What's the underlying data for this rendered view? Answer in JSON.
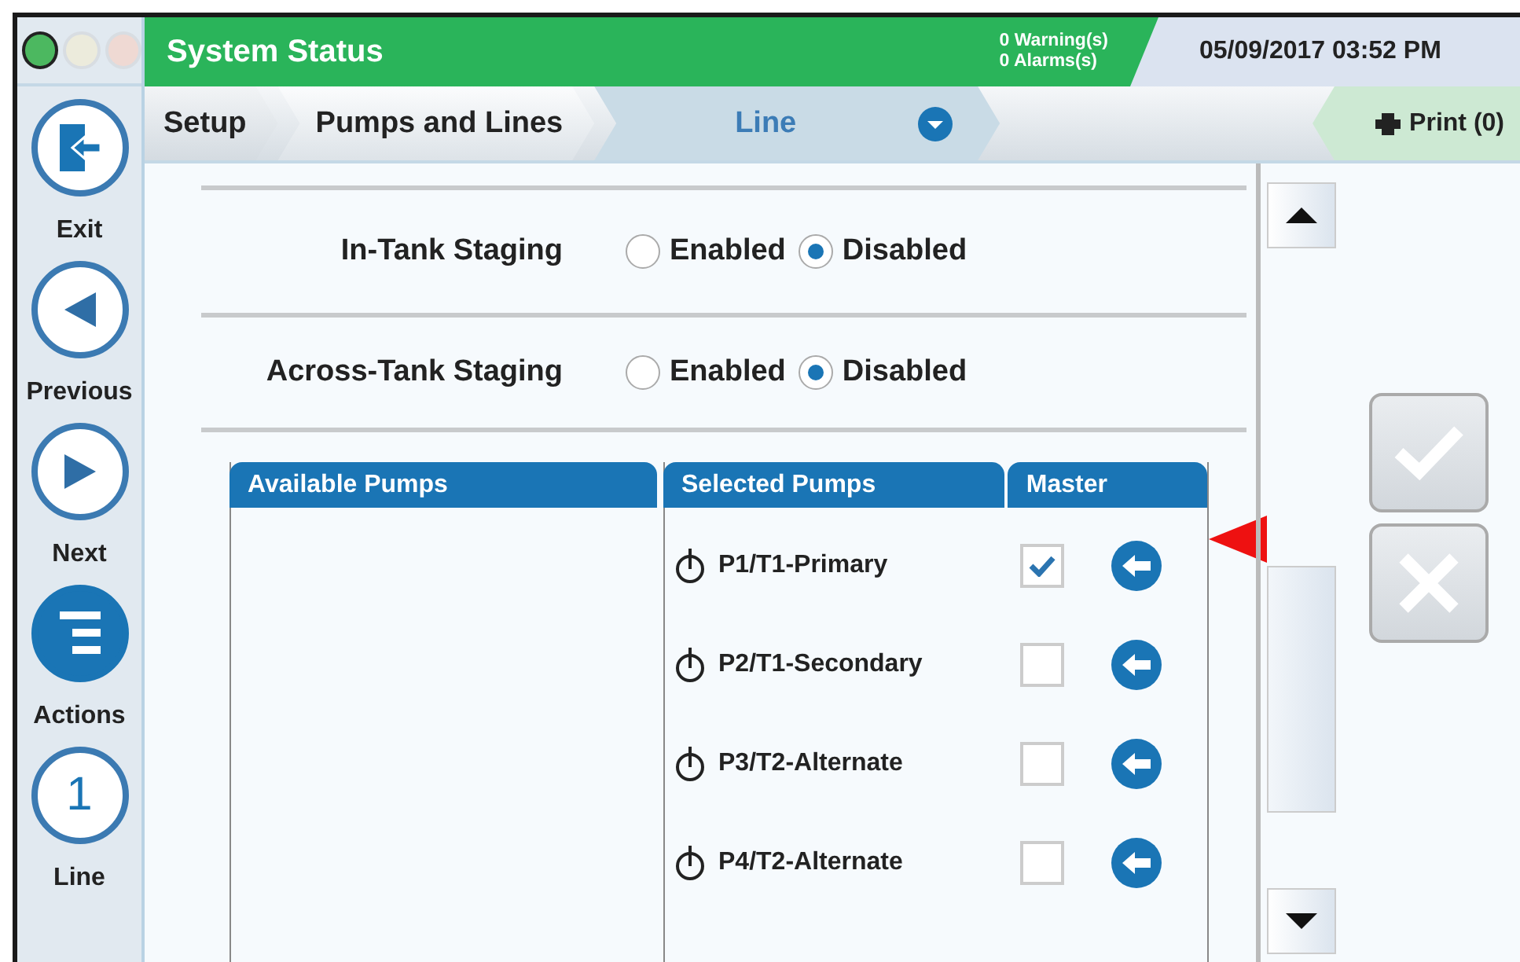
{
  "window": {
    "title": "System Status",
    "warnings": "0 Warning(s)",
    "alarms": "0 Alarms(s)",
    "datetime": "05/09/2017 03:52 PM"
  },
  "status_lights": [
    {
      "color": "#4cb860",
      "on": true
    },
    {
      "color": "#ecebdc",
      "on": false
    },
    {
      "color": "#efd9d3",
      "on": false
    }
  ],
  "sidebar": {
    "items": [
      {
        "kind": "exit",
        "label": "Exit"
      },
      {
        "kind": "previous",
        "label": "Previous"
      },
      {
        "kind": "next",
        "label": "Next"
      },
      {
        "kind": "actions",
        "label": "Actions"
      },
      {
        "kind": "number",
        "label": "Line",
        "number": "1"
      }
    ]
  },
  "breadcrumb": [
    {
      "label": "Setup",
      "selected": false
    },
    {
      "label": "Pumps and Lines",
      "selected": false
    },
    {
      "label": "Line",
      "selected": true
    }
  ],
  "print_button": "Print (0)",
  "staging": [
    {
      "label": "In-Tank Staging",
      "options": [
        {
          "label": "Enabled",
          "selected": false
        },
        {
          "label": "Disabled",
          "selected": true
        }
      ]
    },
    {
      "label": "Across-Tank Staging",
      "options": [
        {
          "label": "Enabled",
          "selected": false
        },
        {
          "label": "Disabled",
          "selected": true
        }
      ]
    }
  ],
  "table": {
    "columns": [
      "Available Pumps",
      "Selected Pumps",
      "Master"
    ],
    "rows": [
      {
        "name": "P1/T1-Primary",
        "checked": true
      },
      {
        "name": "P2/T1-Secondary",
        "checked": false
      },
      {
        "name": "P3/T2-Alternate",
        "checked": false
      },
      {
        "name": "P4/T2-Alternate",
        "checked": false
      }
    ]
  }
}
